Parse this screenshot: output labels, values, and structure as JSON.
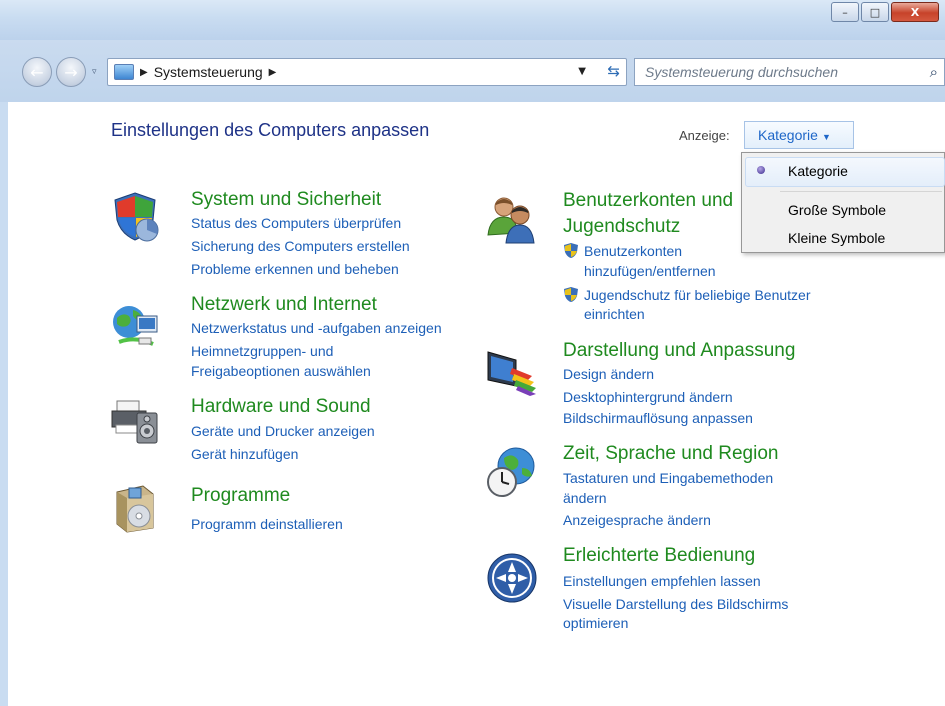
{
  "window": {
    "minimize_glyph": "–",
    "maximize_glyph": "□",
    "close_glyph": "X"
  },
  "nav": {
    "back_glyph": "←",
    "forward_glyph": "→",
    "history_glyph": "▿",
    "breadcrumb_sep": "▶",
    "breadcrumb_item": "Systemsteuerung",
    "breadcrumb_trailing": "▶",
    "dropdown_glyph": "▼",
    "refresh_glyph": "⇆",
    "search_placeholder": "Systemsteuerung durchsuchen",
    "search_glyph": "⌕"
  },
  "header": {
    "title": "Einstellungen des Computers anpassen",
    "view_label": "Anzeige:",
    "view_value": "Kategorie",
    "view_caret": "▼"
  },
  "view_menu": {
    "items": [
      "Kategorie",
      "Große Symbole",
      "Kleine Symbole"
    ],
    "selected": "Kategorie"
  },
  "categories_left": [
    {
      "title": "System und Sicherheit",
      "icon": "security-shield-icon",
      "links": [
        "Status des Computers überprüfen",
        "Sicherung des Computers erstellen",
        "Probleme erkennen und beheben"
      ]
    },
    {
      "title": "Netzwerk und Internet",
      "icon": "network-globe-icon",
      "links": [
        "Netzwerkstatus und -aufgaben anzeigen",
        "Heimnetzgruppen- und",
        "Freigabeoptionen auswählen"
      ]
    },
    {
      "title": "Hardware und Sound",
      "icon": "printer-speaker-icon",
      "links": [
        "Geräte und Drucker anzeigen",
        "Gerät hinzufügen"
      ]
    },
    {
      "title": "Programme",
      "icon": "programs-box-icon",
      "links": [
        "Programm deinstallieren"
      ]
    }
  ],
  "categories_right": [
    {
      "title_line1": "Benutzerkonten und",
      "title_line2": "Jugendschutz",
      "icon": "users-icon",
      "links": [
        "Benutzerkonten",
        "hinzufügen/entfernen",
        "Jugendschutz für beliebige Benutzer",
        "einrichten"
      ]
    },
    {
      "title": "Darstellung und Anpassung",
      "icon": "monitor-palette-icon",
      "links": [
        "Design ändern",
        "Desktophintergrund ändern",
        "Bildschirmauflösung anpassen"
      ]
    },
    {
      "title": "Zeit, Sprache und Region",
      "icon": "globe-clock-icon",
      "links": [
        "Tastaturen und Eingabemethoden",
        "ändern",
        "Anzeigesprache ändern"
      ]
    },
    {
      "title": "Erleichterte Bedienung",
      "icon": "accessibility-icon",
      "links": [
        "Einstellungen empfehlen lassen",
        "Visuelle Darstellung des Bildschirms",
        "optimieren"
      ]
    }
  ],
  "colors": {
    "category_title": "#1f8a1f",
    "link": "#1d5fb7",
    "page_title": "#1e3287",
    "chrome": "#c9dcf1"
  }
}
